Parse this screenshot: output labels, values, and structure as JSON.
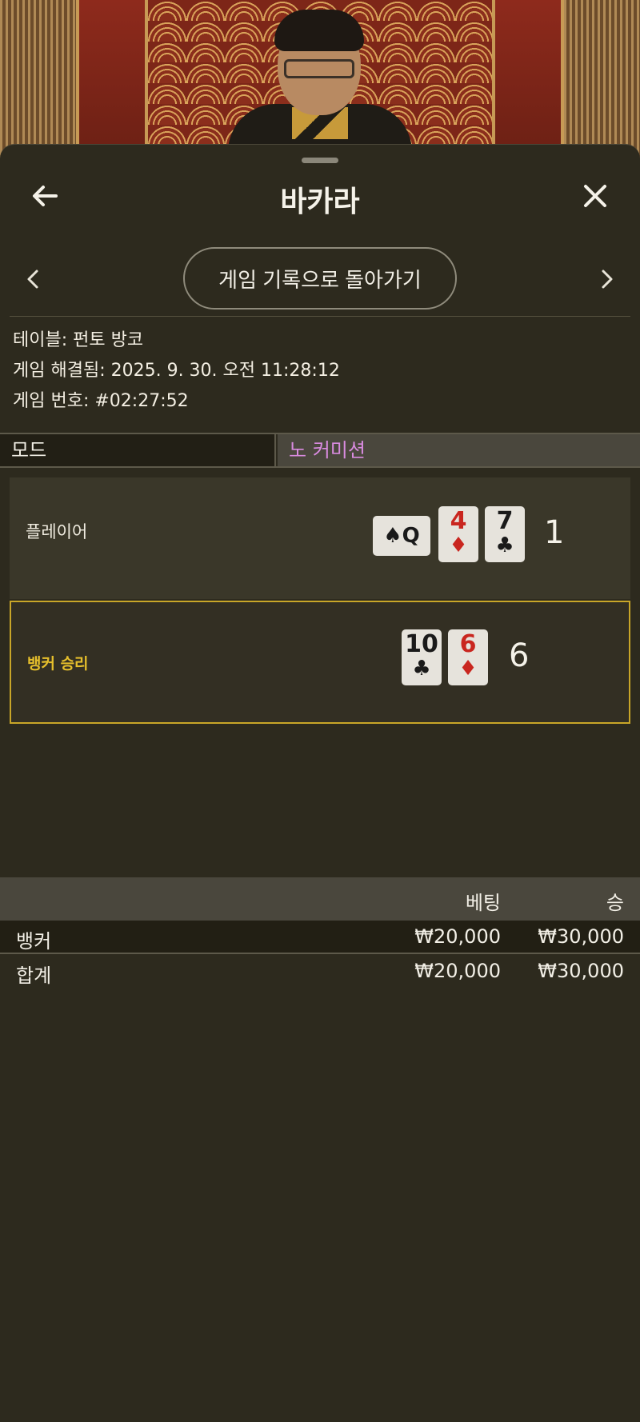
{
  "header": {
    "title": "바카라",
    "back_icon": "arrow-left-icon",
    "close_icon": "close-icon"
  },
  "nav": {
    "back_to_history_label": "게임 기록으로 돌아가기",
    "prev_icon": "chevron-left-icon",
    "next_icon": "chevron-right-icon"
  },
  "game_info": {
    "table": "테이블: 펀토 방코",
    "resolved": "게임 해결됨: 2025. 9. 30. 오전 11:28:12",
    "number": "게임 번호: #02:27:52"
  },
  "mode": {
    "label": "모드",
    "value": "노 커미션"
  },
  "hands": {
    "player": {
      "label": "플레이어",
      "score": "1",
      "cards": [
        {
          "rank": "Q",
          "suit": "♠",
          "color": "black",
          "sideways": true
        },
        {
          "rank": "4",
          "suit": "♦",
          "color": "red"
        },
        {
          "rank": "7",
          "suit": "♣",
          "color": "black"
        }
      ]
    },
    "banker": {
      "label": "뱅커 승리",
      "score": "6",
      "cards": [
        {
          "rank": "10",
          "suit": "♣",
          "color": "black"
        },
        {
          "rank": "6",
          "suit": "♦",
          "color": "red"
        }
      ]
    }
  },
  "bets_table": {
    "col_bet": "베팅",
    "col_win": "승",
    "rows": [
      {
        "name": "뱅커",
        "bet": "₩20,000",
        "win": "₩30,000"
      },
      {
        "name": "합계",
        "bet": "₩20,000",
        "win": "₩30,000"
      }
    ]
  },
  "colors": {
    "background": "#2d2a1e",
    "mode_value": "#d98be0",
    "banker_highlight": "#c9a628",
    "red_suit": "#c9261f"
  }
}
